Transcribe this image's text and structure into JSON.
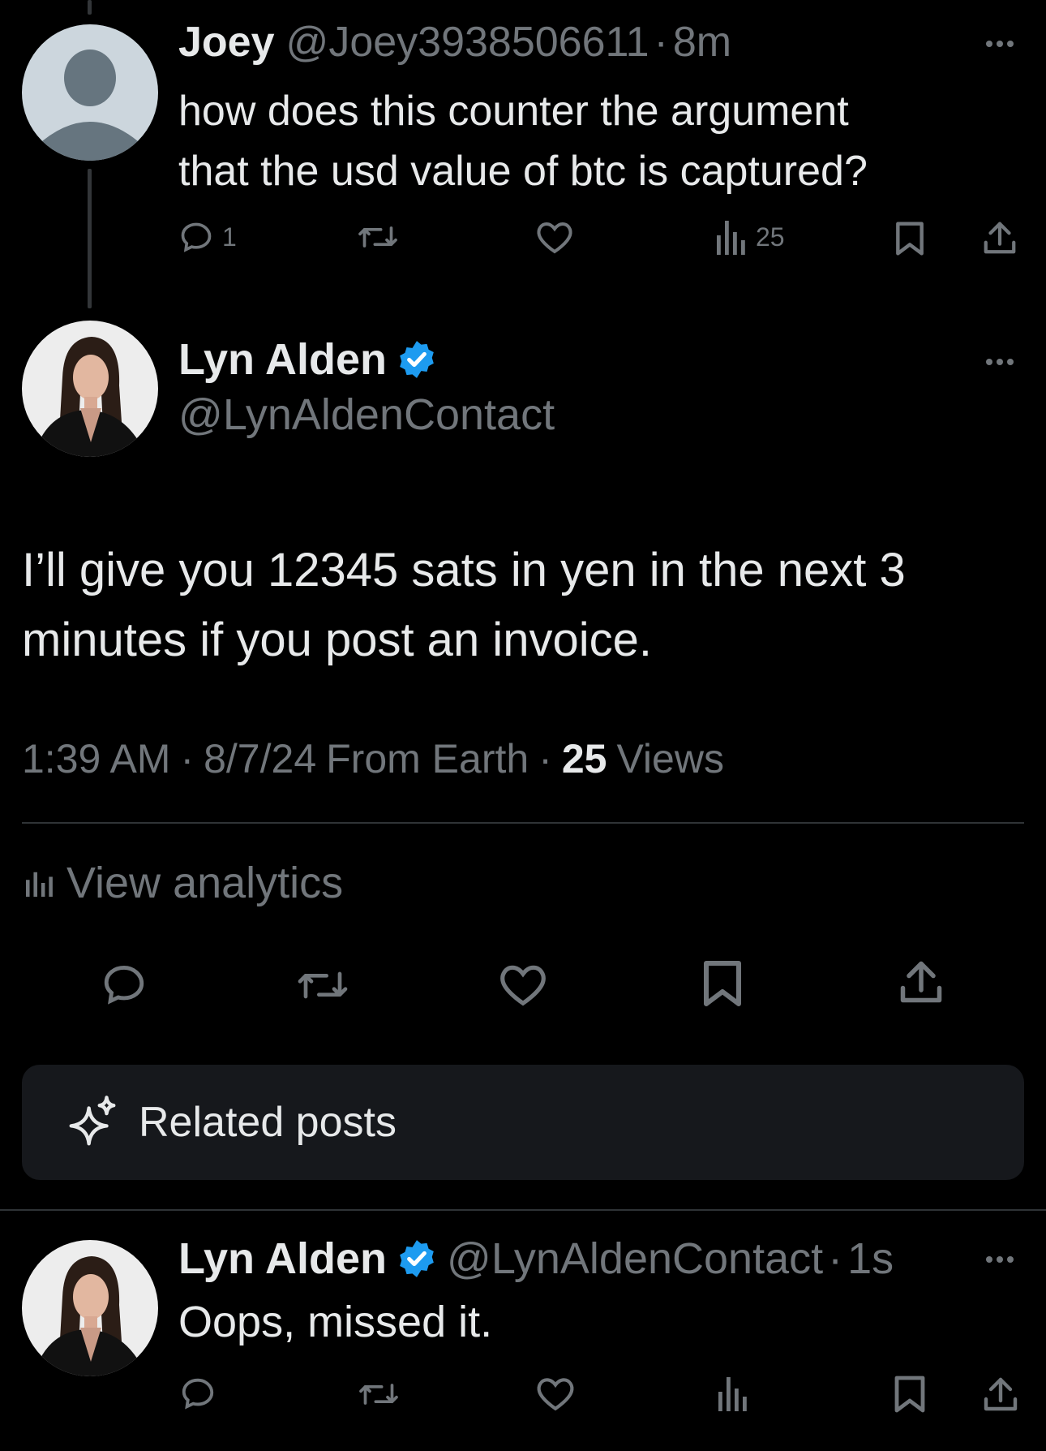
{
  "reply_parent": {
    "name": "Joey",
    "handle": "@Joey3938506611",
    "separator": "·",
    "time": "8m",
    "text_line1": "how does this counter the argument",
    "text_line2": "that the usd value of btc is captured?",
    "reply_count": "1",
    "view_count": "25"
  },
  "main_post": {
    "name": "Lyn Alden",
    "handle": "@LynAldenContact",
    "text_line1": "I’ll give you 12345 sats in yen in the next 3",
    "text_line2": "minutes if you post an invoice.",
    "time": "1:39 AM",
    "date": "8/7/24",
    "source": "From Earth",
    "separator": "·",
    "views_count": "25",
    "views_label": "Views",
    "analytics_label": "View analytics",
    "related_label": "Related posts"
  },
  "reply_post": {
    "name": "Lyn Alden",
    "handle": "@LynAldenContact",
    "separator": "·",
    "time": "1s",
    "text": "Oops, missed it."
  },
  "colors": {
    "background": "#000000",
    "text": "#e7e9ea",
    "muted": "#71767b",
    "verified": "#1d9bf0",
    "card": "#16181c"
  }
}
